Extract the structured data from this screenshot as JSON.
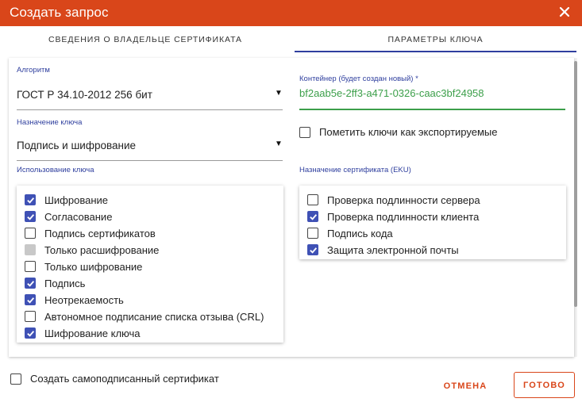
{
  "dialog": {
    "title": "Создать запрос"
  },
  "tabs": [
    {
      "label": "СВЕДЕНИЯ О ВЛАДЕЛЬЦЕ СЕРТИФИКАТА"
    },
    {
      "label": "ПАРАМЕТРЫ КЛЮЧА",
      "active": true
    }
  ],
  "algorithm": {
    "label": "Алгоритм",
    "value": "ГОСТ Р 34.10-2012 256 бит"
  },
  "key_purpose": {
    "label": "Назначение ключа",
    "value": "Подпись и шифрование"
  },
  "container": {
    "label": "Контейнер (будет создан новый) *",
    "value": "bf2aab5e-2ff3-a471-0326-caac3bf24958"
  },
  "exportable": {
    "label": "Пометить ключи как экспортируемые",
    "checked": false
  },
  "key_usage": {
    "label": "Использование ключа",
    "items": [
      {
        "label": "Шифрование",
        "state": "checked"
      },
      {
        "label": "Согласование",
        "state": "checked"
      },
      {
        "label": "Подпись сертификатов",
        "state": "unchecked"
      },
      {
        "label": "Только расшифрование",
        "state": "disabled"
      },
      {
        "label": "Только шифрование",
        "state": "unchecked"
      },
      {
        "label": "Подпись",
        "state": "checked"
      },
      {
        "label": "Неотрекаемость",
        "state": "checked"
      },
      {
        "label": "Автономное подписание списка отзыва (CRL)",
        "state": "unchecked"
      },
      {
        "label": "Шифрование ключа",
        "state": "checked"
      }
    ]
  },
  "eku": {
    "label": "Назначение сертификата (EKU)",
    "items": [
      {
        "label": "Проверка подлинности сервера",
        "state": "unchecked"
      },
      {
        "label": "Проверка подлинности клиента",
        "state": "checked"
      },
      {
        "label": "Подпись кода",
        "state": "unchecked"
      },
      {
        "label": "Защита электронной почты",
        "state": "checked"
      }
    ]
  },
  "self_signed": {
    "label": "Создать самоподписанный сертификат",
    "checked": false
  },
  "buttons": {
    "cancel": "ОТМЕНА",
    "ok": "ГОТОВО"
  },
  "colors": {
    "accent": "#d9461a",
    "primary": "#3f51b5",
    "label": "#2f3f9e",
    "success": "#3c9f4a"
  }
}
